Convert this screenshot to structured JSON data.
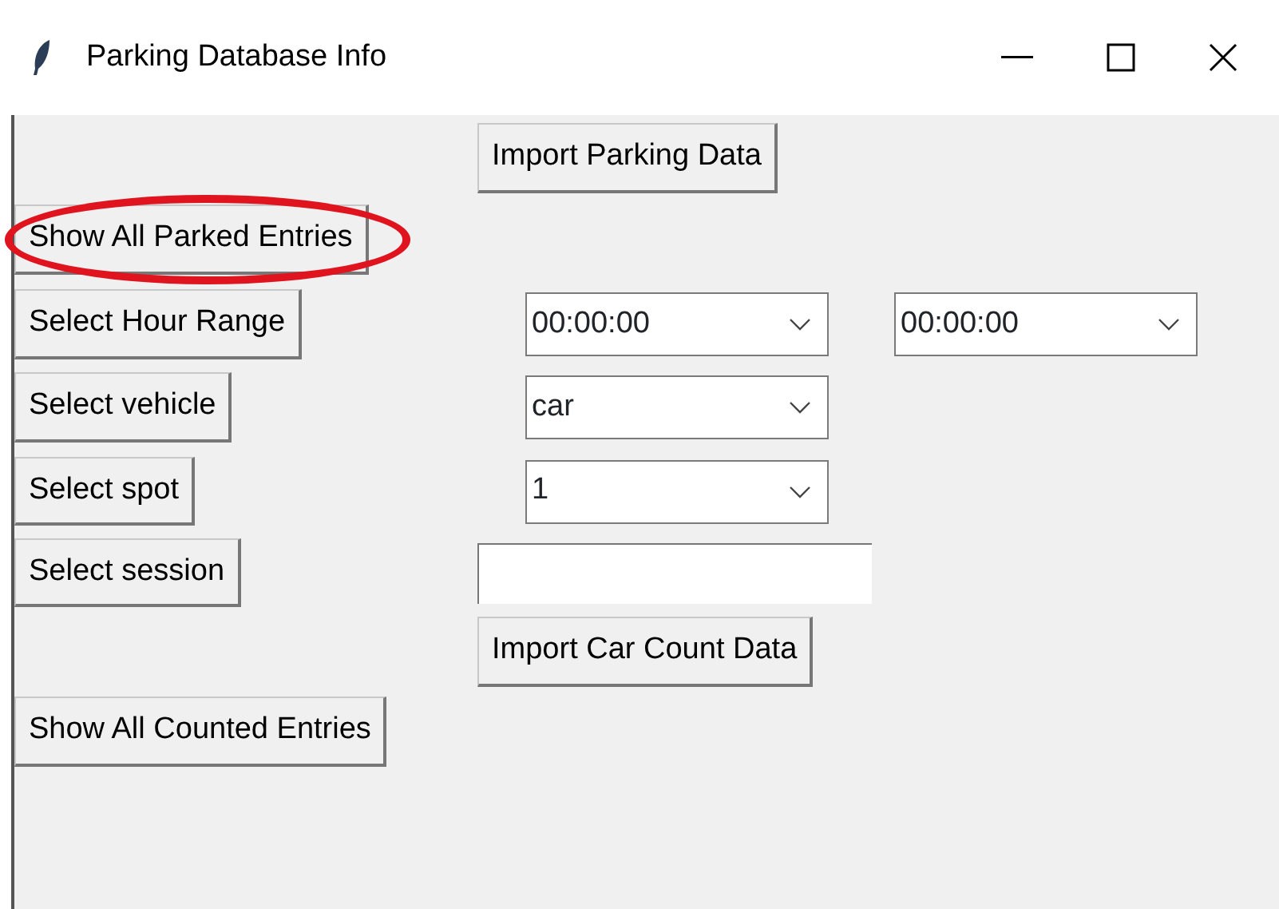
{
  "window": {
    "title": "Parking Database Info"
  },
  "widgets": [
    {
      "kind": "button",
      "label": "Import Parking Data",
      "highlighted": false
    },
    {
      "kind": "button",
      "label": "Show All Parked Entries",
      "highlighted": true
    },
    {
      "kind": "button",
      "label": "Select Hour Range",
      "highlighted": false
    },
    {
      "kind": "combo",
      "value": "00:00:00"
    },
    {
      "kind": "combo",
      "value": "00:00:00"
    },
    {
      "kind": "button",
      "label": "Select vehicle",
      "highlighted": false
    },
    {
      "kind": "combo",
      "value": "car"
    },
    {
      "kind": "button",
      "label": "Select spot",
      "highlighted": false
    },
    {
      "kind": "combo",
      "value": "1"
    },
    {
      "kind": "button",
      "label": "Select session",
      "highlighted": false
    },
    {
      "kind": "entry"
    },
    {
      "kind": "button",
      "label": "Import Car Count Data",
      "highlighted": false
    },
    {
      "kind": "button",
      "label": "Show All Counted Entries",
      "highlighted": false
    }
  ]
}
